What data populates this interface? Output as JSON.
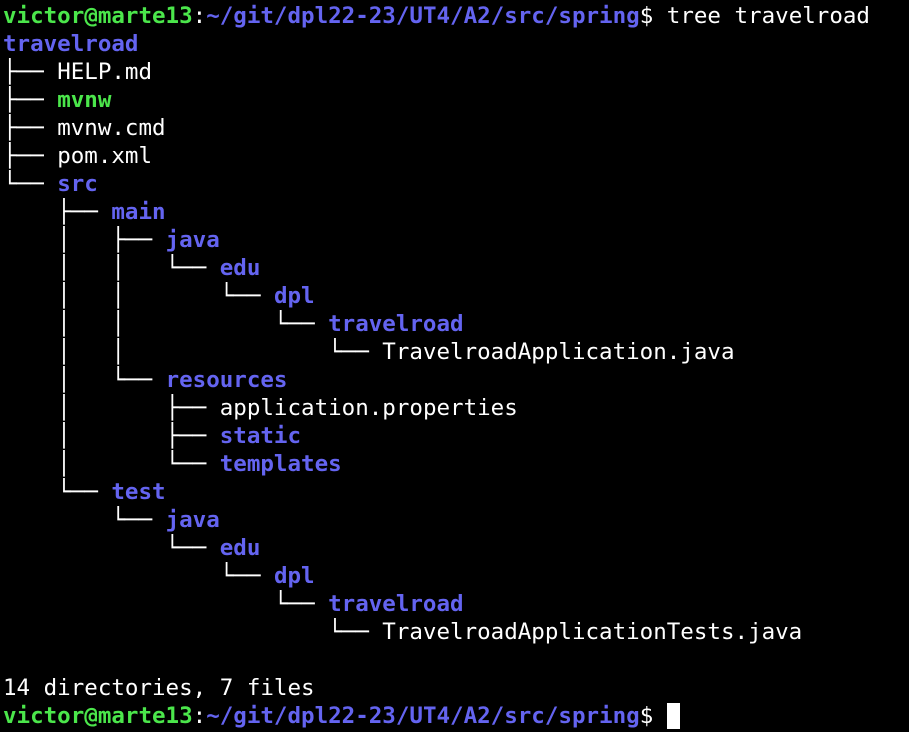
{
  "prompt": {
    "user_host": "victor@marte13",
    "sep": ":",
    "path": "~/git/dpl22-23/UT4/A2/src/spring",
    "symbol": "$ "
  },
  "command": "tree travelroad",
  "colors": {
    "background": "#000000",
    "prompt_green": "#4be64b",
    "directory_blue": "#6464f0",
    "text": "#ffffff"
  },
  "tree": [
    {
      "prefix": "",
      "name": "travelroad",
      "type": "dir"
    },
    {
      "prefix": "├── ",
      "name": "HELP.md",
      "type": "file"
    },
    {
      "prefix": "├── ",
      "name": "mvnw",
      "type": "exec"
    },
    {
      "prefix": "├── ",
      "name": "mvnw.cmd",
      "type": "file"
    },
    {
      "prefix": "├── ",
      "name": "pom.xml",
      "type": "file"
    },
    {
      "prefix": "└── ",
      "name": "src",
      "type": "dir"
    },
    {
      "prefix": "    ├── ",
      "name": "main",
      "type": "dir"
    },
    {
      "prefix": "    │   ├── ",
      "name": "java",
      "type": "dir"
    },
    {
      "prefix": "    │   │   └── ",
      "name": "edu",
      "type": "dir"
    },
    {
      "prefix": "    │   │       └── ",
      "name": "dpl",
      "type": "dir"
    },
    {
      "prefix": "    │   │           └── ",
      "name": "travelroad",
      "type": "dir"
    },
    {
      "prefix": "    │   │               └── ",
      "name": "TravelroadApplication.java",
      "type": "file"
    },
    {
      "prefix": "    │   └── ",
      "name": "resources",
      "type": "dir"
    },
    {
      "prefix": "    │       ├── ",
      "name": "application.properties",
      "type": "file"
    },
    {
      "prefix": "    │       ├── ",
      "name": "static",
      "type": "dir"
    },
    {
      "prefix": "    │       └── ",
      "name": "templates",
      "type": "dir"
    },
    {
      "prefix": "    └── ",
      "name": "test",
      "type": "dir"
    },
    {
      "prefix": "        └── ",
      "name": "java",
      "type": "dir"
    },
    {
      "prefix": "            └── ",
      "name": "edu",
      "type": "dir"
    },
    {
      "prefix": "                └── ",
      "name": "dpl",
      "type": "dir"
    },
    {
      "prefix": "                    └── ",
      "name": "travelroad",
      "type": "dir"
    },
    {
      "prefix": "                        └── ",
      "name": "TravelroadApplicationTests.java",
      "type": "file"
    }
  ],
  "summary": "14 directories, 7 files"
}
